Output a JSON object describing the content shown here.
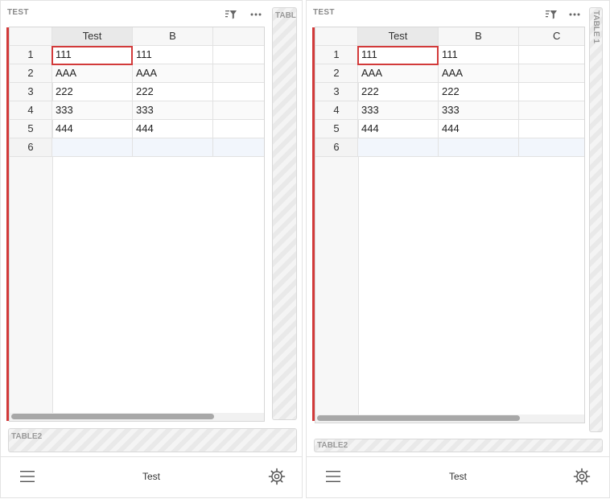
{
  "left": {
    "section_title": "TEST",
    "side_tab_label": "TABLE",
    "bottom_tab_label": "TABLE2",
    "footer_title": "Test"
  },
  "right": {
    "section_title": "TEST",
    "side_tab_label": "TABLE 1",
    "bottom_tab_label": "TABLE2",
    "footer_title": "Test"
  },
  "table": {
    "columns": [
      "Test",
      "B",
      "C"
    ],
    "rows": [
      {
        "num": "1",
        "cells": [
          "111",
          "111",
          ""
        ]
      },
      {
        "num": "2",
        "cells": [
          "AAA",
          "AAA",
          ""
        ]
      },
      {
        "num": "3",
        "cells": [
          "222",
          "222",
          ""
        ]
      },
      {
        "num": "4",
        "cells": [
          "333",
          "333",
          ""
        ]
      },
      {
        "num": "5",
        "cells": [
          "444",
          "444",
          ""
        ]
      },
      {
        "num": "6",
        "cells": [
          "",
          "",
          ""
        ]
      }
    ]
  },
  "icons": {
    "filter": "sort-filter-icon",
    "more": "more-dots-icon",
    "menu": "hamburger-menu-icon",
    "settings": "gear-icon"
  },
  "colors": {
    "accent": "#d23a3a"
  }
}
